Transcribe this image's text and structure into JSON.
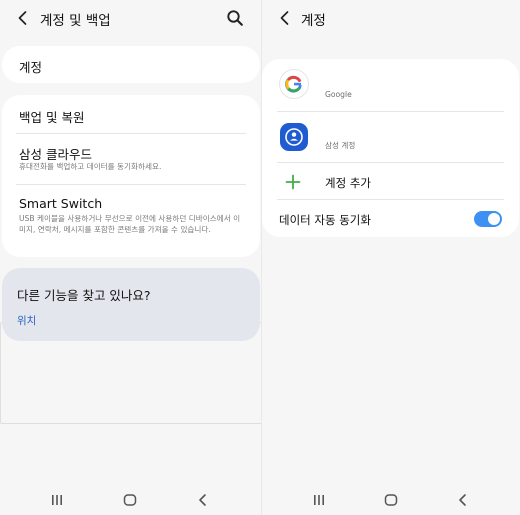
{
  "left": {
    "header": {
      "title": "계정 및 백업",
      "back_icon": "back-arrow-icon",
      "search_icon": "search-icon"
    },
    "account_item": {
      "title": "계정"
    },
    "backup_group": {
      "items": [
        {
          "title": "백업 및 복원",
          "subtitle": ""
        },
        {
          "title": "삼성 클라우드",
          "subtitle": "휴대전화를 백업하고 데이터를 동기화하세요."
        },
        {
          "title": "Smart Switch",
          "subtitle": "USB 케이블을 사용하거나 무선으로 이전에 사용하던 디바이스에서 이미지, 연락처, 메시지를 포함한 콘텐츠를 가져올 수 있습니다."
        }
      ]
    },
    "find_more": {
      "title": "다른 기능을 찾고 있나요?",
      "link": "위치"
    }
  },
  "right": {
    "header": {
      "title": "계정",
      "back_icon": "back-arrow-icon"
    },
    "accounts": [
      {
        "label": "Google",
        "icon": "google-icon"
      },
      {
        "label": "삼성 계정",
        "icon": "samsung-account-icon"
      }
    ],
    "add_account": {
      "label": "계정 추가",
      "icon": "plus-icon"
    },
    "auto_sync": {
      "label": "데이터 자동 동기화",
      "enabled": true
    }
  },
  "nav": {
    "icons": [
      "recents-icon",
      "home-icon",
      "back-icon"
    ]
  },
  "colors": {
    "background": "#f6f6f6",
    "card": "#ffffff",
    "find_card": "#e3e7ed",
    "link": "#2a63c1",
    "toggle_on": "#3e91f2",
    "plus": "#3fae49",
    "samsung_icon_bg": "#1f5bd1"
  }
}
